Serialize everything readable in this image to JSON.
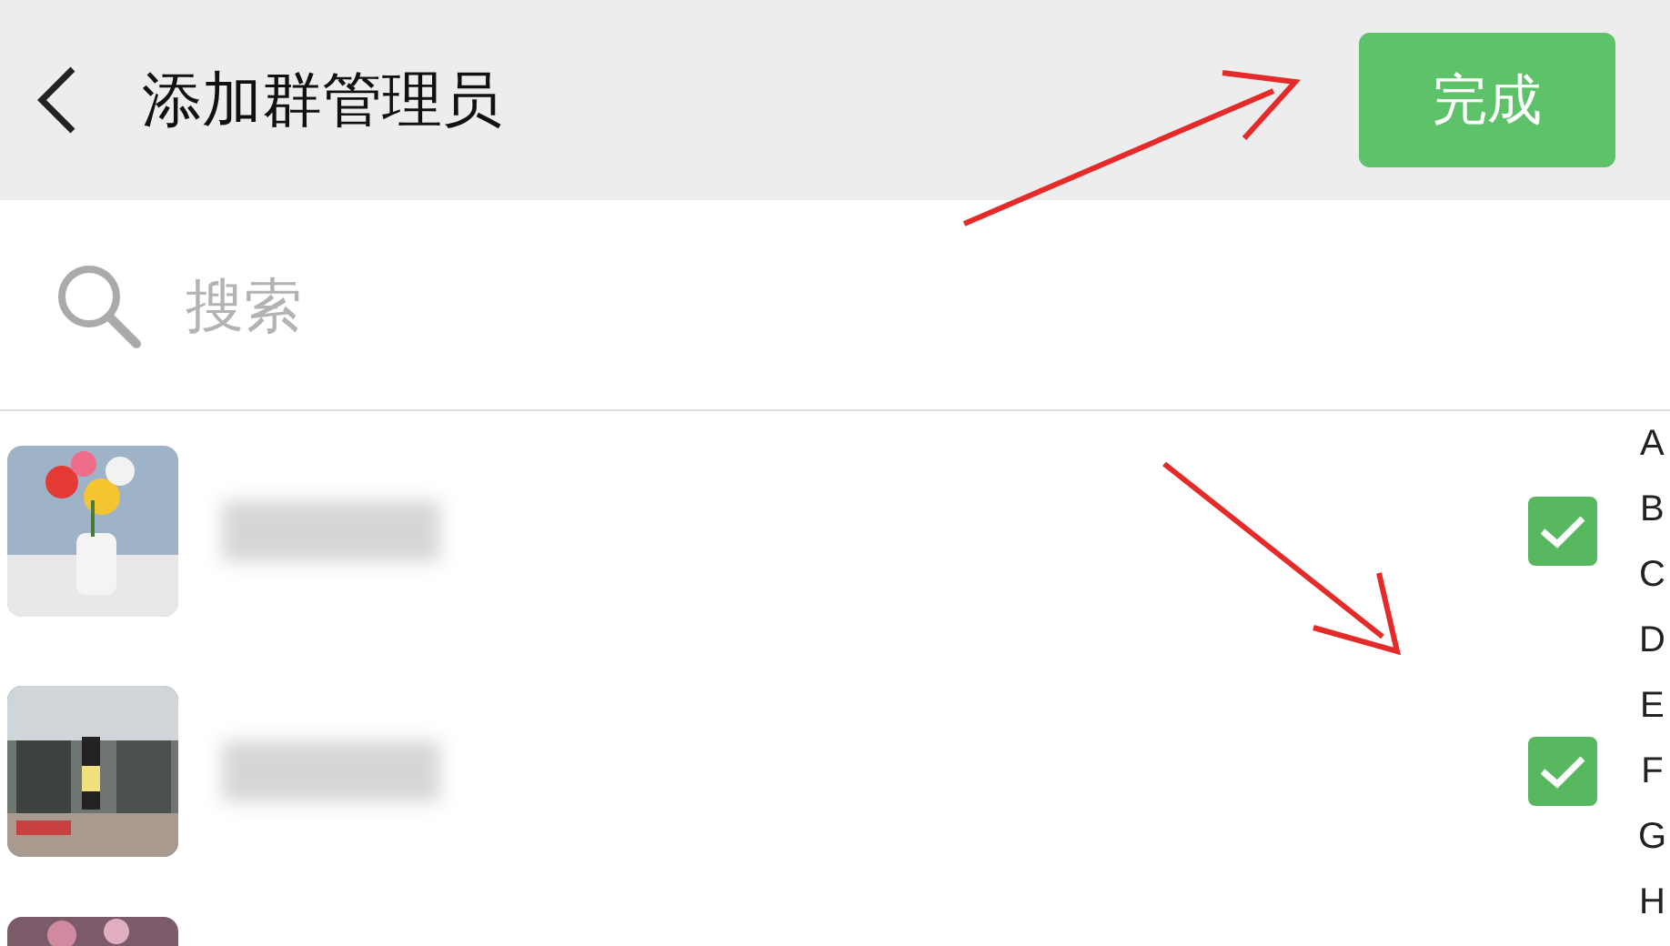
{
  "header": {
    "title": "添加群管理员",
    "done_button": "完成"
  },
  "search": {
    "placeholder": "搜索"
  },
  "contacts": [
    {
      "checked": true
    },
    {
      "checked": true
    }
  ],
  "index_letters": [
    "A",
    "B",
    "C",
    "D",
    "E",
    "F",
    "G",
    "H"
  ]
}
